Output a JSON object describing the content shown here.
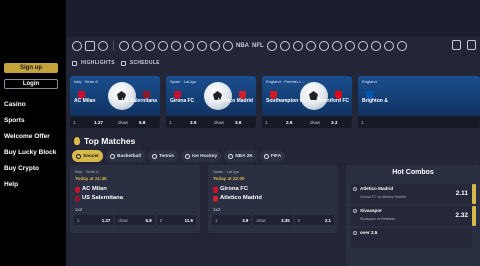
{
  "sidebar": {
    "signup": "Sign up",
    "login": "Login",
    "items": [
      "Casino",
      "Sports",
      "Welcome Offer",
      "Buy Lucky Block",
      "Buy Crypto",
      "Help"
    ]
  },
  "tabs": {
    "highlights": "HIGHLIGHTS",
    "schedule": "SCHEDULE"
  },
  "iconbar": {
    "nba_label": "NBA",
    "nfl_label": "NFL"
  },
  "hero": [
    {
      "league": "Italy · Serie A",
      "home": "AC Milan",
      "away": "US Salernitana",
      "odds": [
        "1",
        "1.27",
        "draw",
        "5.8"
      ]
    },
    {
      "league": "Spain · LaLiga",
      "home": "Girona FC",
      "away": "Atletico Madrid",
      "odds": [
        "1",
        "3.9",
        "draw",
        "3.6"
      ]
    },
    {
      "league": "England · Premier L...",
      "home": "Southampton FC",
      "away": "Brentford FC",
      "odds": [
        "1",
        "2.5",
        "draw",
        "3.3"
      ]
    },
    {
      "league": "England",
      "home": "Brighton &",
      "away": "",
      "odds": [
        "1",
        "",
        "",
        ""
      ]
    }
  ],
  "section": {
    "title": "Top Matches"
  },
  "sports": [
    "Soccer",
    "Basketball",
    "Tennis",
    "Ice Hockey",
    "NBA 2K",
    "FIFA"
  ],
  "matches": [
    {
      "league": "Italy · Serie A",
      "time": "Today at 21:45",
      "home": "AC Milan",
      "away": "US Salernitana",
      "market": "1x2",
      "odds": [
        [
          "1",
          "1.27"
        ],
        [
          "draw",
          "5.8"
        ],
        [
          "2",
          "11.5"
        ]
      ]
    },
    {
      "league": "Spain · LaLiga",
      "time": "Today at 22:00",
      "home": "Girona FC",
      "away": "Atletico Madrid",
      "market": "1x2",
      "odds": [
        [
          "1",
          "3.9"
        ],
        [
          "draw",
          "3.35"
        ],
        [
          "2",
          "2.1"
        ]
      ]
    }
  ],
  "combos": {
    "title": "Hot Combos",
    "items": [
      {
        "name": "Atletico Madrid",
        "sub": "Girona FC vs Atletico Madrid",
        "odd": "2.11"
      },
      {
        "name": "Sivasspor",
        "sub": "Sivasspor vs Besiktas",
        "odd": "2.32"
      },
      {
        "name": "over 2.5",
        "sub": "",
        "odd": ""
      }
    ]
  },
  "colors": {
    "accent": "#d7b84a",
    "sidebar": "#000000",
    "panel": "#2b2f42"
  }
}
